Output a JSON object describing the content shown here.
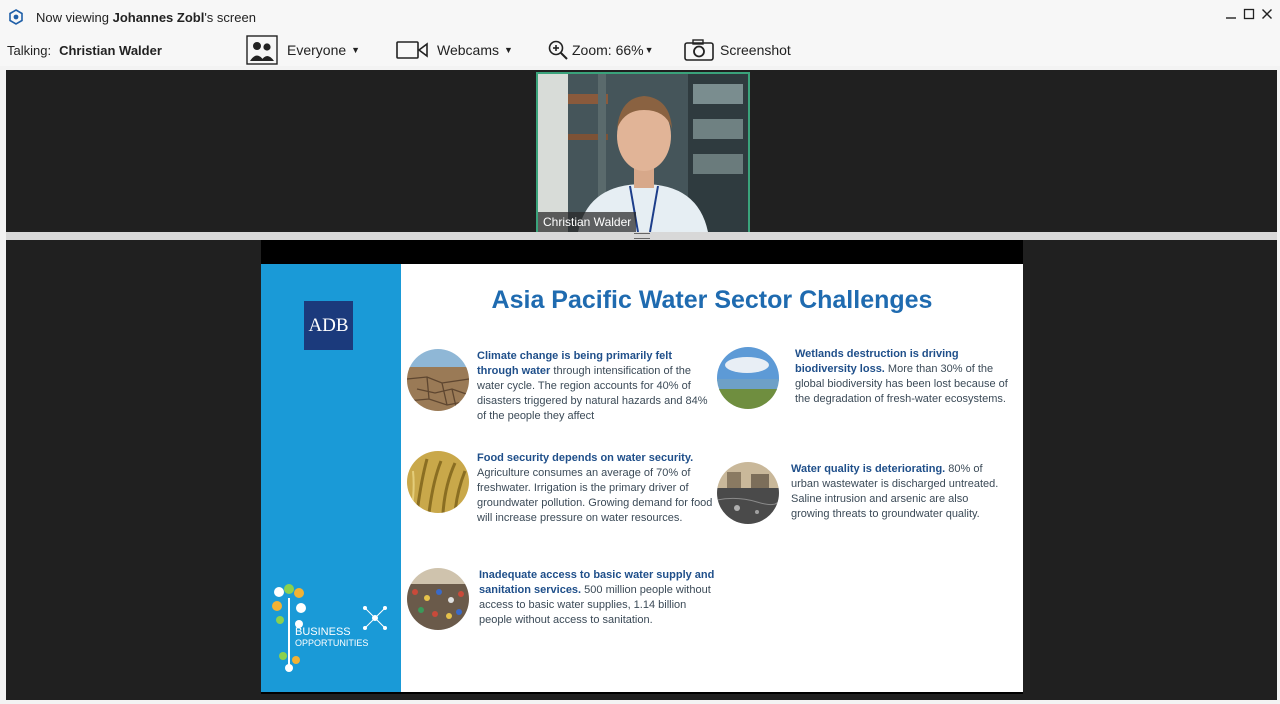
{
  "titlebar": {
    "prefix": "Now viewing ",
    "presenter": "Johannes Zobl",
    "suffix": "'s screen"
  },
  "toolbar": {
    "talking_label": "Talking:",
    "talking_name": "Christian Walder",
    "audience_label": "Everyone",
    "webcams_label": "Webcams",
    "zoom_label": "Zoom: 66%",
    "screenshot_label": "Screenshot"
  },
  "webcam": {
    "name": "Christian Walder"
  },
  "slide": {
    "logo": "ADB",
    "title": "Asia Pacific Water Sector Challenges",
    "brand_line1": "BUSINESS",
    "brand_line2": "OPPORTUNITIES",
    "items": [
      {
        "bold": "Climate change is being primarily felt through water",
        "rest": " through intensification of the water cycle. The region accounts for 40% of disasters triggered by natural hazards and 84% of the people they affect"
      },
      {
        "bold": "Wetlands destruction is driving biodiversity loss.",
        "rest": " More than 30% of the global biodiversity has been lost because of the degradation of fresh-water ecosystems."
      },
      {
        "bold": "Food security depends on water security.",
        "rest": " Agriculture consumes an average of 70% of freshwater. Irrigation is the primary driver of groundwater pollution. Growing demand for food will increase pressure on water resources."
      },
      {
        "bold": "Water quality is deteriorating.",
        "rest": " 80% of urban wastewater is discharged untreated. Saline intrusion and arsenic are also growing threats to groundwater quality."
      },
      {
        "bold": "Inadequate access to basic water supply and sanitation services.",
        "rest": " 500 million people without access to basic water supplies, 1.14 billion people without access to sanitation."
      }
    ]
  },
  "colors": {
    "accent_blue": "#1a9ad7",
    "title_blue": "#1f6bb0",
    "webcam_border": "#3aa37b"
  }
}
